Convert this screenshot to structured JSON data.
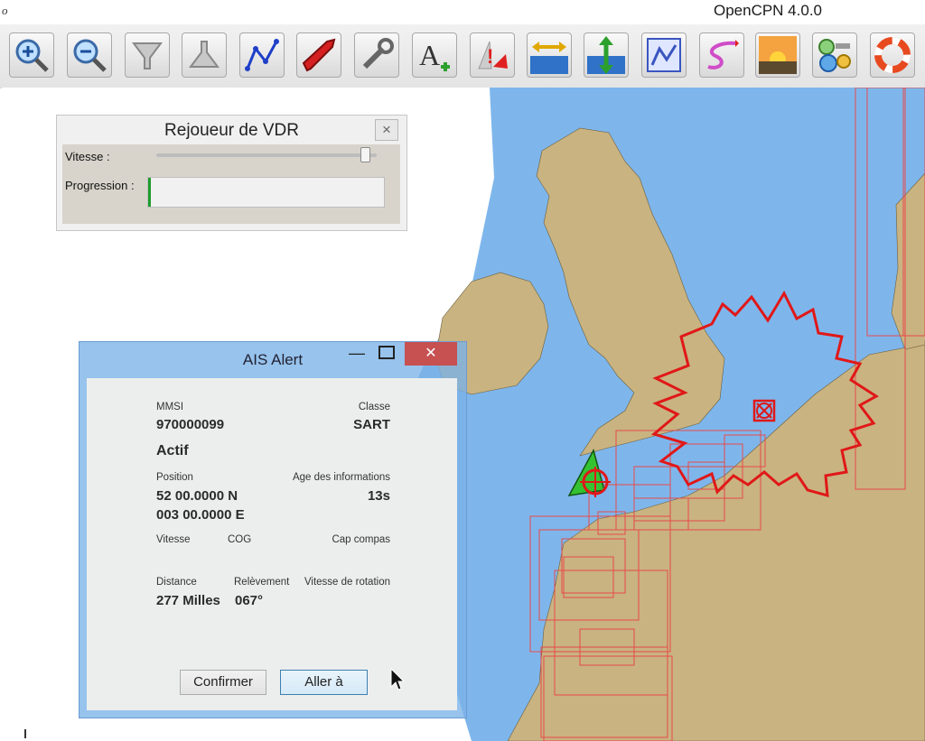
{
  "window": {
    "title": "OpenCPN 4.0.0",
    "icon_glyph": "o"
  },
  "toolbar": {
    "buttons": [
      {
        "name": "zoom-in",
        "icon": "magnifier-plus-icon"
      },
      {
        "name": "zoom-out",
        "icon": "magnifier-minus-icon"
      },
      {
        "name": "scale-in",
        "icon": "funnel-down-icon"
      },
      {
        "name": "scale-out",
        "icon": "funnel-up-icon"
      },
      {
        "name": "route",
        "icon": "route-icon"
      },
      {
        "name": "auto-follow",
        "icon": "ship-icon"
      },
      {
        "name": "toolbox",
        "icon": "wrench-icon"
      },
      {
        "name": "text",
        "icon": "text-add-icon"
      },
      {
        "name": "ais",
        "icon": "ais-warning-icon"
      },
      {
        "name": "current",
        "icon": "current-icon"
      },
      {
        "name": "tide",
        "icon": "tide-icon"
      },
      {
        "name": "route-manager",
        "icon": "route-manager-icon"
      },
      {
        "name": "track",
        "icon": "track-icon"
      },
      {
        "name": "color-scheme",
        "icon": "sunset-icon"
      },
      {
        "name": "plugins",
        "icon": "plugins-icon"
      },
      {
        "name": "mob",
        "icon": "lifebuoy-icon"
      }
    ]
  },
  "vdr": {
    "title": "Rejoueur de VDR",
    "close": "×",
    "speed_label": "Vitesse :",
    "speed_value": 0.97,
    "progress_label": "Progression :",
    "progress_value": 0.0
  },
  "ais": {
    "title": "AIS Alert",
    "minimize": "—",
    "close": "✕",
    "mmsi_label": "MMSI",
    "mmsi_value": "970000099",
    "class_label": "Classe",
    "class_value": "SART",
    "status": "Actif",
    "position_label": "Position",
    "age_label": "Age des informations",
    "lat": "52 00.0000 N",
    "lon": "003 00.0000 E",
    "age_value": "13s",
    "speed_label": "Vitesse",
    "cog_label": "COG",
    "heading_label": "Cap compas",
    "distance_label": "Distance",
    "bearing_label": "Relèvement",
    "rot_label": "Vitesse de rotation",
    "distance_value": "277 Milles",
    "bearing_value": "067°",
    "confirm_button": "Confirmer",
    "goto_button": "Aller à"
  },
  "colors": {
    "sea": "#7eb6ec",
    "land": "#c9b381",
    "chart_outline": "#e84a4a",
    "sart": "#e01818",
    "ownship": "#35c232",
    "close_button": "#c75050"
  }
}
